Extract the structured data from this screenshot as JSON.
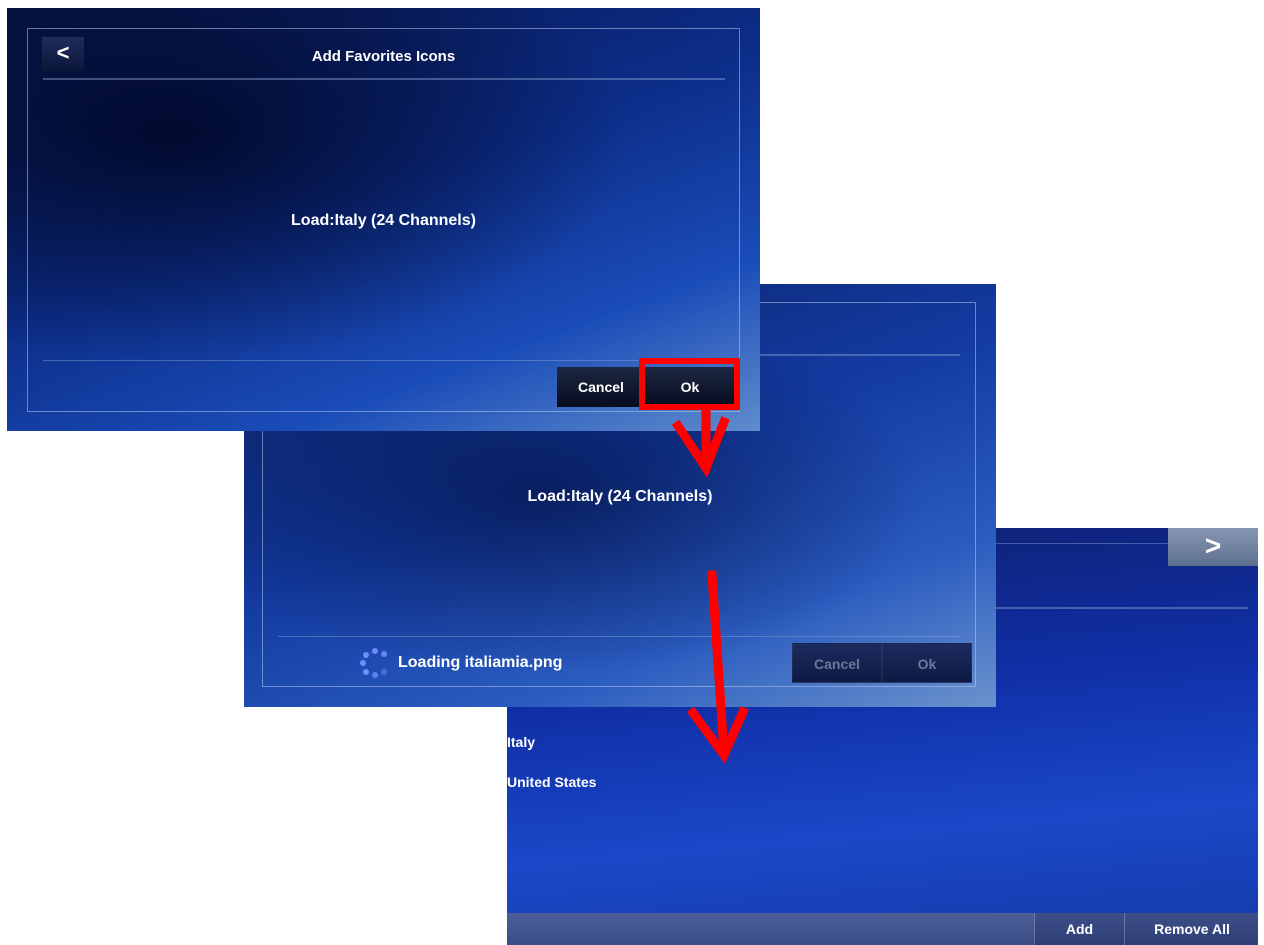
{
  "screen_back": {
    "next_icon": "chevron-right-icon",
    "next_label": ">",
    "list": [
      "Italy",
      "United States"
    ],
    "buttons": {
      "add": "Add",
      "remove_all": "Remove All"
    }
  },
  "screen_loading": {
    "center_text": "Load:Italy (24 Channels)",
    "loading_text": "Loading italiamia.png",
    "spinner_icon": "loading-spinner-icon",
    "buttons": {
      "cancel": "Cancel",
      "ok": "Ok"
    }
  },
  "screen_front": {
    "back_icon": "chevron-left-icon",
    "back_label": "<",
    "title": "Add Favorites Icons",
    "center_text": "Load:Italy (24 Channels)",
    "buttons": {
      "cancel": "Cancel",
      "ok": "Ok"
    }
  },
  "annotation": {
    "highlight_color": "#ff0000",
    "arrow_color": "#ff0000"
  }
}
